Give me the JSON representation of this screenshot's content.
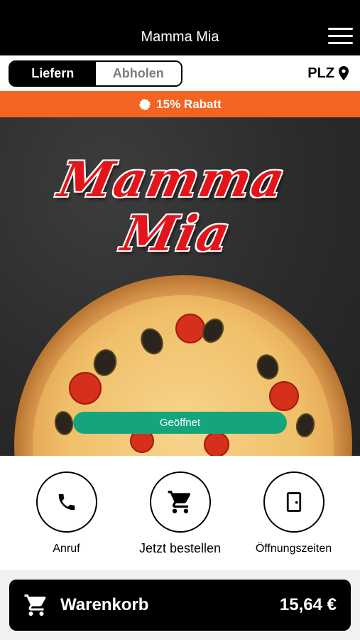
{
  "header": {
    "title": "Mamma Mia",
    "menu_icon": "hamburger-menu-icon"
  },
  "order_mode": {
    "deliver_label": "Liefern",
    "pickup_label": "Abholen",
    "selected": "Liefern"
  },
  "postcode": {
    "label": "PLZ",
    "icon": "location-pin-icon"
  },
  "promo": {
    "text": "15% Rabatt",
    "icon": "badge-icon",
    "color": "#f26421"
  },
  "hero": {
    "logo_line1": "Mamma",
    "logo_line2": "Mia",
    "status": "Geöffnet",
    "status_color": "#14a57c"
  },
  "actions": [
    {
      "label": "Anruf",
      "icon": "phone-icon"
    },
    {
      "label": "Jetzt bestellen",
      "icon": "shopping-cart-icon"
    },
    {
      "label": "Öffnungszeiten",
      "icon": "door-icon"
    }
  ],
  "cart": {
    "label": "Warenkorb",
    "total": "15,64 €",
    "icon": "shopping-cart-icon"
  }
}
